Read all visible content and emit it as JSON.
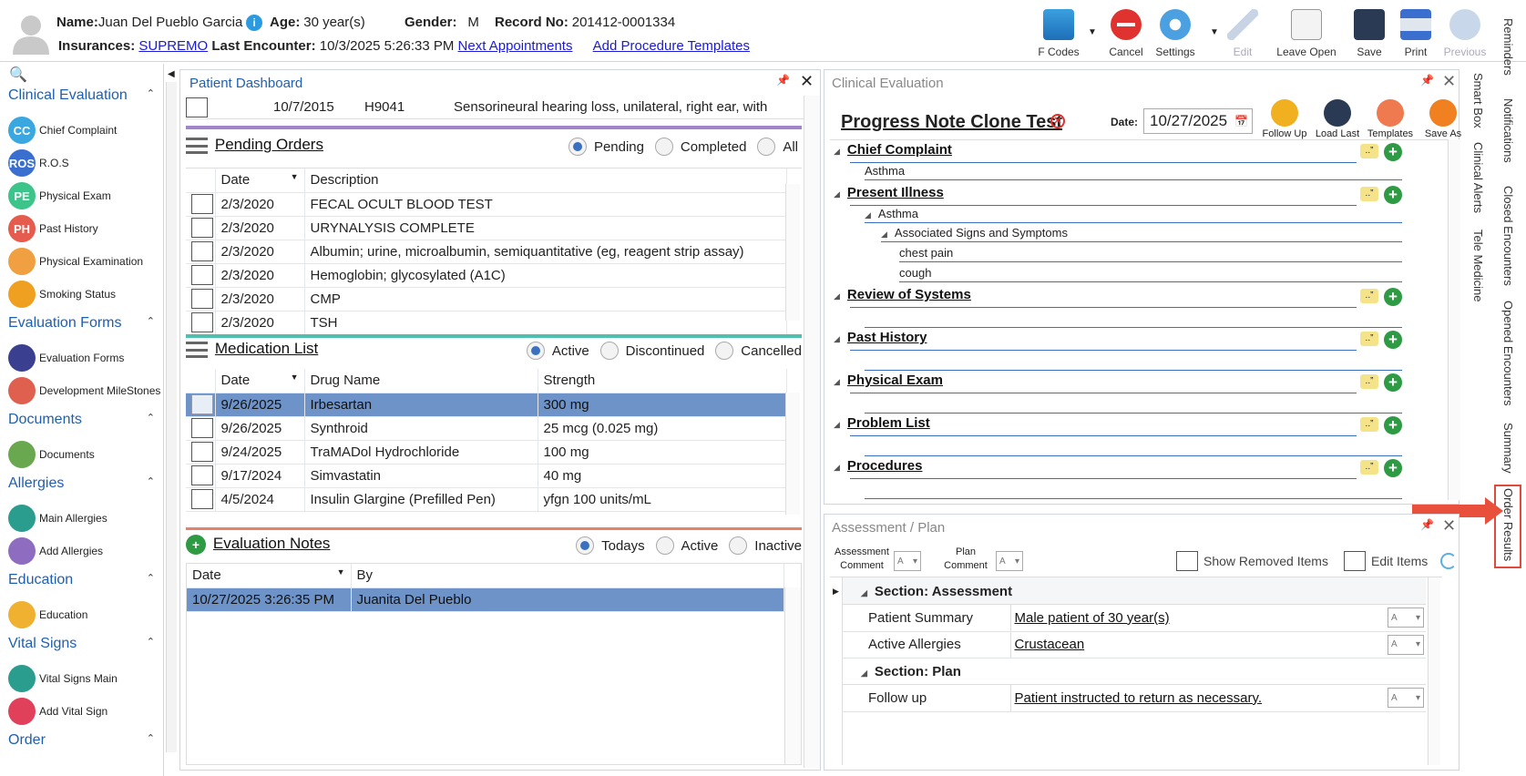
{
  "patient": {
    "name_label": "Name:",
    "name": "Juan Del Pueblo Garcia",
    "age_label": "Age:",
    "age": "30 year(s)",
    "gender_label": "Gender:",
    "gender": "M",
    "record_label": "Record No:",
    "record": "201412-0001334",
    "insurances_label": "Insurances:",
    "insurance": "SUPREMO",
    "last_encounter_label": "Last Encounter:",
    "last_encounter": "10/3/2025 5:26:33 PM",
    "next_appointments": "Next Appointments",
    "add_procedure_templates": "Add Procedure Templates"
  },
  "toolbar": {
    "fcodes": "F Codes",
    "cancel": "Cancel",
    "settings": "Settings",
    "edit": "Edit",
    "leave_open": "Leave Open",
    "save": "Save",
    "print": "Print",
    "previous": "Previous"
  },
  "right_tabs": {
    "outer": [
      "Reminders",
      "Notifications",
      "Closed Encounters",
      "Opened Encounters",
      "Summary",
      "Order Results"
    ],
    "inner": [
      "Smart Box",
      "Clinical Alerts",
      "Tele Medicine"
    ]
  },
  "leftnav": {
    "sections": [
      {
        "title": "Clinical Evaluation",
        "items": [
          {
            "label": "Chief Complaint",
            "icon": "CC",
            "color": "#3aa7e0"
          },
          {
            "label": "R.O.S",
            "icon": "ROS",
            "color": "#3a6fd0"
          },
          {
            "label": "Physical Exam",
            "icon": "PE",
            "color": "#3cc48a"
          },
          {
            "label": "Past History",
            "icon": "PH",
            "color": "#e55b4e"
          },
          {
            "label": "Physical Examination",
            "icon": "clipboard",
            "color": "#f0a040"
          },
          {
            "label": "Smoking Status",
            "icon": "no-smoking",
            "color": "#f0a020"
          }
        ]
      },
      {
        "title": "Evaluation Forms",
        "items": [
          {
            "label": "Evaluation Forms",
            "icon": "form",
            "color": "#3b3f8f"
          },
          {
            "label": "Development MileStones",
            "icon": "milestones",
            "color": "#e06050"
          }
        ]
      },
      {
        "title": "Documents",
        "items": [
          {
            "label": "Documents",
            "icon": "binders",
            "color": "#6aa84f"
          }
        ]
      },
      {
        "title": "Allergies",
        "items": [
          {
            "label": "Main Allergies",
            "icon": "pill-bottle",
            "color": "#2a9d8f"
          },
          {
            "label": "Add Allergies",
            "icon": "pills",
            "color": "#8e6cc0"
          }
        ]
      },
      {
        "title": "Education",
        "items": [
          {
            "label": "Education",
            "icon": "reader",
            "color": "#f0b030"
          }
        ]
      },
      {
        "title": "Vital Signs",
        "items": [
          {
            "label": "Vital Signs Main",
            "icon": "heart-pulse",
            "color": "#2a9d8f"
          },
          {
            "label": "Add Vital Sign",
            "icon": "heart-plus",
            "color": "#e0405a"
          }
        ]
      },
      {
        "title": "Order",
        "items": []
      }
    ]
  },
  "dashboard": {
    "title": "Patient Dashboard",
    "problem_row": {
      "date": "10/7/2015",
      "code": "H9041",
      "desc": "Sensorineural hearing loss, unilateral, right ear, with"
    },
    "pending": {
      "title": "Pending Orders",
      "filters": [
        "Pending",
        "Completed",
        "All"
      ],
      "selected": "Pending",
      "columns": [
        "Date",
        "Description"
      ],
      "rows": [
        [
          "2/3/2020",
          "FECAL OCULT BLOOD TEST"
        ],
        [
          "2/3/2020",
          "URYNALYSIS COMPLETE"
        ],
        [
          "2/3/2020",
          "Albumin; urine, microalbumin, semiquantitative (eg, reagent strip assay)"
        ],
        [
          "2/3/2020",
          "Hemoglobin; glycosylated (A1C)"
        ],
        [
          "2/3/2020",
          "CMP"
        ],
        [
          "2/3/2020",
          "TSH"
        ]
      ]
    },
    "meds": {
      "title": "Medication List",
      "filters": [
        "Active",
        "Discontinued",
        "Cancelled"
      ],
      "selected": "Active",
      "columns": [
        "Date",
        "Drug Name",
        "Strength"
      ],
      "rows": [
        [
          "9/26/2025",
          "Irbesartan",
          "300 mg"
        ],
        [
          "9/26/2025",
          "Synthroid",
          "25 mcg (0.025 mg)"
        ],
        [
          "9/24/2025",
          "TraMADol Hydrochloride",
          "100 mg"
        ],
        [
          "9/17/2024",
          "Simvastatin",
          "40 mg"
        ],
        [
          "4/5/2024",
          "Insulin Glargine (Prefilled Pen)",
          "yfgn 100 units/mL"
        ]
      ]
    },
    "evalnotes": {
      "title": "Evaluation Notes",
      "filters": [
        "Todays",
        "Active",
        "Inactive"
      ],
      "selected": "Todays",
      "columns": [
        "Date",
        "By"
      ],
      "rows": [
        [
          "10/27/2025 3:26:35 PM",
          "Juanita Del Pueblo"
        ]
      ]
    }
  },
  "clinical": {
    "title": "Clinical Evaluation",
    "note_title": "Progress Note Clone Test",
    "date_label": "Date:",
    "date": "10/27/2025",
    "actions": [
      "Follow Up",
      "Load Last",
      "Templates",
      "Save As"
    ],
    "sections": [
      "Chief Complaint",
      "Present Illness",
      "Review of Systems",
      "Past History",
      "Physical Exam",
      "Problem List",
      "Procedures"
    ],
    "cc_item": "Asthma",
    "pi_item": "Asthma",
    "pi_sub": "Associated Signs and Symptoms",
    "pi_symptoms": [
      "chest pain",
      "cough"
    ]
  },
  "assessment": {
    "title": "Assessment / Plan",
    "assessment_comment": "Assessment Comment",
    "plan_comment": "Plan Comment",
    "show_removed": "Show Removed Items",
    "edit_items": "Edit Items",
    "section_assessment": "Section: Assessment",
    "section_plan": "Section: Plan",
    "rows": [
      {
        "label": "Patient Summary",
        "value": "Male patient of 30 year(s)"
      },
      {
        "label": "Active Allergies",
        "value": "Crustacean"
      },
      {
        "label": "Follow up",
        "value": "Patient instructed to return as necessary."
      }
    ]
  }
}
